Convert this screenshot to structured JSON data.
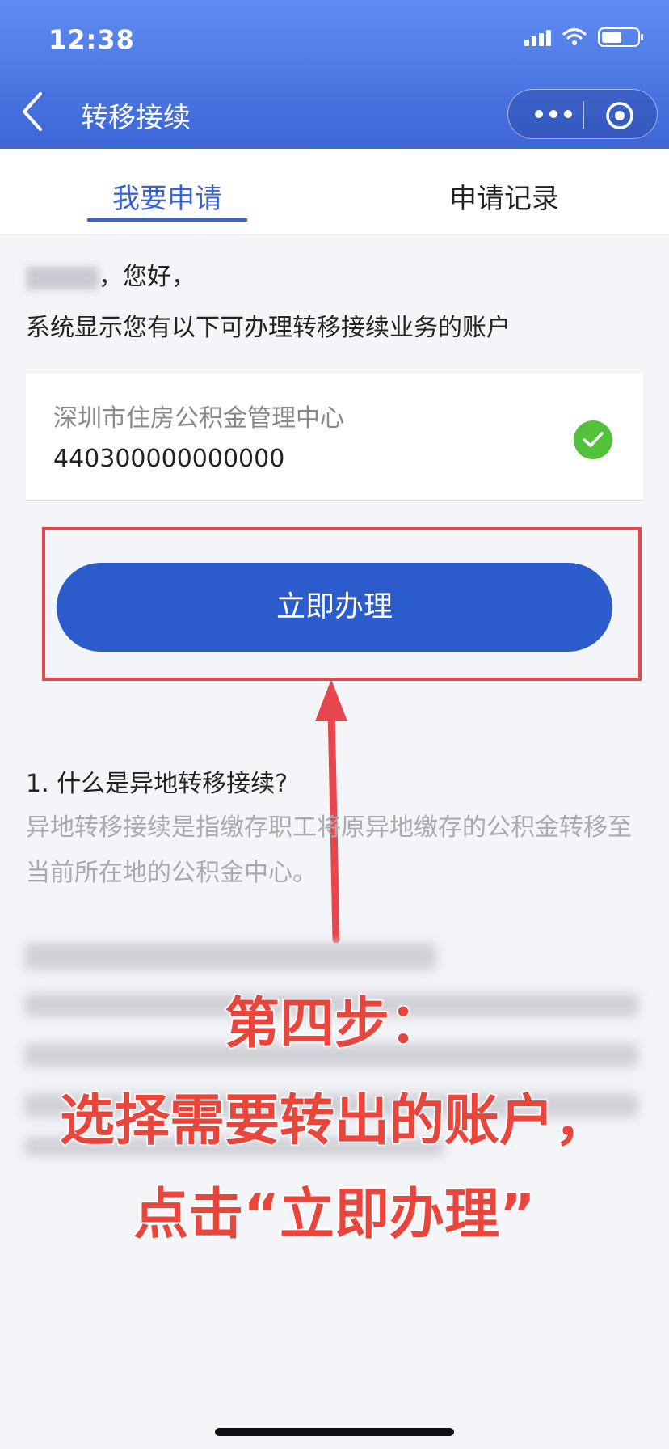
{
  "status_bar": {
    "time": "12:38"
  },
  "nav": {
    "title": "转移接续"
  },
  "tabs": [
    {
      "label": "我要申请",
      "active": true
    },
    {
      "label": "申请记录",
      "active": false
    }
  ],
  "greeting": {
    "suffix": "，您好，",
    "message": "系统显示您有以下可办理转移接续业务的账户"
  },
  "account": {
    "name": "深圳市住房公积金管理中心",
    "number": "440300000000000",
    "selected": true
  },
  "action": {
    "label": "立即办理"
  },
  "faq": {
    "question": "1. 什么是异地转移接续?",
    "answer": "异地转移接续是指缴存职工将原异地缴存的公积金转移至当前所在地的公积金中心。"
  },
  "annotation": {
    "line1": "第四步：",
    "line2": "选择需要转出的账户，",
    "line3": "点击“立即办理”"
  },
  "colors": {
    "primary": "#2c5ccb",
    "highlight": "#e5474d",
    "check": "#52c23a"
  }
}
